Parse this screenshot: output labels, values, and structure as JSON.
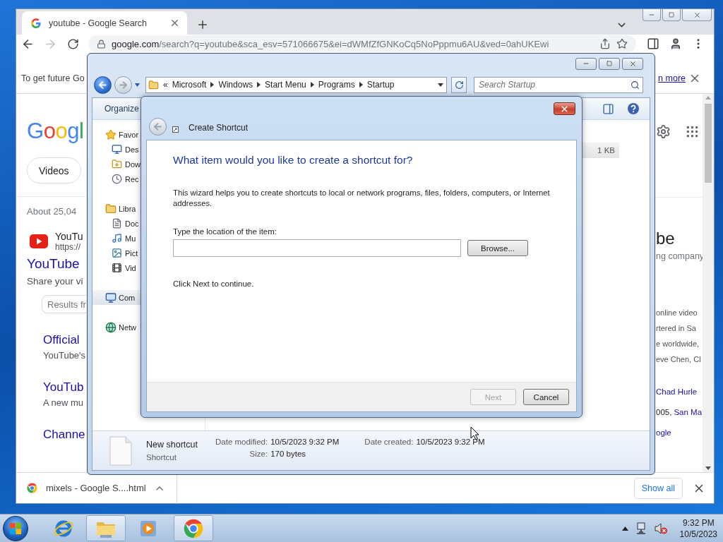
{
  "browser": {
    "tabs": [
      {
        "title": "youtube - Google Search",
        "selected": true
      }
    ],
    "navigation": {
      "back_disabled": false,
      "forward_disabled": true
    },
    "address": {
      "host": "google.com",
      "path": "/search?q=youtube&sca_esv=571066675&ei=dWMfZfGNKoCq5NoPppmu6AU&ved=0ahUKEwi"
    },
    "infobar": {
      "message": "To get future Go",
      "link": "n more"
    },
    "results": {
      "logo": "Googl",
      "chip": "Videos",
      "stats": "About 25,04",
      "site": "YouTu",
      "site_url": "https://",
      "title": "YouTube",
      "snippet": "Share your vi",
      "results_from": "Results fr",
      "sitelinks": [
        {
          "title": "Official",
          "snippet": "YouTube's"
        },
        {
          "title": "YouTub",
          "snippet": "A new mu"
        },
        {
          "title": "Channe"
        }
      ]
    },
    "knowledge_panel": {
      "title": "be",
      "subtitle": "ng company",
      "description": [
        "online video",
        "rtered in Sa",
        "e worldwide,",
        "eve Chen, Cl"
      ],
      "facts": [
        {
          "link": "Chad Hurle"
        },
        {
          "text": "005,",
          "link": "San Ma"
        },
        {
          "link": "ogle"
        }
      ]
    },
    "downloads": {
      "file": "mixels - Google S....html",
      "show_all": "Show all"
    }
  },
  "explorer": {
    "navigation": {
      "back_disabled": false,
      "forward_disabled": true
    },
    "overflow": "«",
    "breadcrumb": [
      "Microsoft",
      "Windows",
      "Start Menu",
      "Programs",
      "Startup"
    ],
    "search_placeholder": "Search Startup",
    "organize": "Organize",
    "nav": [
      {
        "label": "Favor",
        "kind": "star",
        "selected": false,
        "children": [
          {
            "label": "Des",
            "kind": "desktop",
            "selected": false
          },
          {
            "label": "Dow",
            "kind": "downloads",
            "selected": false
          },
          {
            "label": "Rec",
            "kind": "recent",
            "selected": false
          }
        ]
      },
      {
        "label": "Libra",
        "kind": "libraries",
        "selected": false,
        "children": [
          {
            "label": "Doc",
            "kind": "documents",
            "selected": false
          },
          {
            "label": "Mu",
            "kind": "music",
            "selected": false
          },
          {
            "label": "Pict",
            "kind": "pictures",
            "selected": false
          },
          {
            "label": "Vid",
            "kind": "videos",
            "selected": false
          }
        ]
      },
      {
        "label": "Com",
        "kind": "computer",
        "selected": true
      },
      {
        "label": "Netw",
        "kind": "network",
        "selected": false
      }
    ],
    "file_size": "1 KB",
    "details": {
      "name": "New shortcut",
      "type": "Shortcut",
      "fields": [
        {
          "label": "Date modified:",
          "value": "10/5/2023 9:32 PM"
        },
        {
          "label": "Size:",
          "value": "170 bytes"
        },
        {
          "label": "Date created:",
          "value": "10/5/2023 9:32 PM"
        }
      ]
    }
  },
  "dialog": {
    "title": "Create Shortcut",
    "back_disabled": true,
    "heading": "What item would you like to create a shortcut for?",
    "description": "This wizard helps you to create shortcuts to local or network programs, files, folders, computers, or Internet addresses.",
    "location_label": "Type the location of the item:",
    "browse": "Browse...",
    "hint": "Click Next to continue.",
    "buttons": [
      {
        "label": "Next",
        "disabled": true
      },
      {
        "label": "Cancel",
        "disabled": false
      }
    ]
  },
  "taskbar": {
    "apps": [
      {
        "kind": "ie",
        "running": false
      },
      {
        "kind": "explorer",
        "running": true
      },
      {
        "kind": "media",
        "running": false
      },
      {
        "kind": "chrome",
        "running": true
      }
    ],
    "clock": {
      "time": "9:32 PM",
      "date": "10/5/2023"
    }
  }
}
